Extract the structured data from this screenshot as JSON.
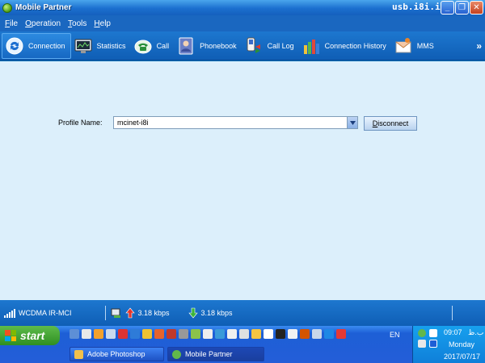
{
  "window": {
    "title": "Mobile Partner",
    "watermark": "usb.i8i.ir",
    "min_glyph": "_",
    "max_glyph": "❐",
    "close_glyph": "✕"
  },
  "menu": [
    "File",
    "Operation",
    "Tools",
    "Help"
  ],
  "toolbar": {
    "items": [
      {
        "label": "Connection",
        "icon": "connection-icon"
      },
      {
        "label": "Statistics",
        "icon": "statistics-icon"
      },
      {
        "label": "Call",
        "icon": "call-icon"
      },
      {
        "label": "Phonebook",
        "icon": "phonebook-icon"
      },
      {
        "label": "Call Log",
        "icon": "call-log-icon"
      },
      {
        "label": "Connection History",
        "icon": "connection-history-icon"
      },
      {
        "label": "MMS",
        "icon": "mms-icon"
      }
    ],
    "more_glyph": "»"
  },
  "profile": {
    "label": "Profile Name:",
    "value": "mcinet-i8i",
    "button": "Disconnect"
  },
  "status": {
    "network": "WCDMA IR-MCI",
    "upload": "3.18 kbps",
    "download": "3.18 kbps"
  },
  "taskbar": {
    "start": "start",
    "lang": "EN",
    "tasks": [
      "Adobe Photoshop",
      "Mobile Partner"
    ],
    "clock": {
      "time": "09:07",
      "ampm": "ب.ظ",
      "day": "Monday",
      "date": "2017/07/17"
    }
  }
}
